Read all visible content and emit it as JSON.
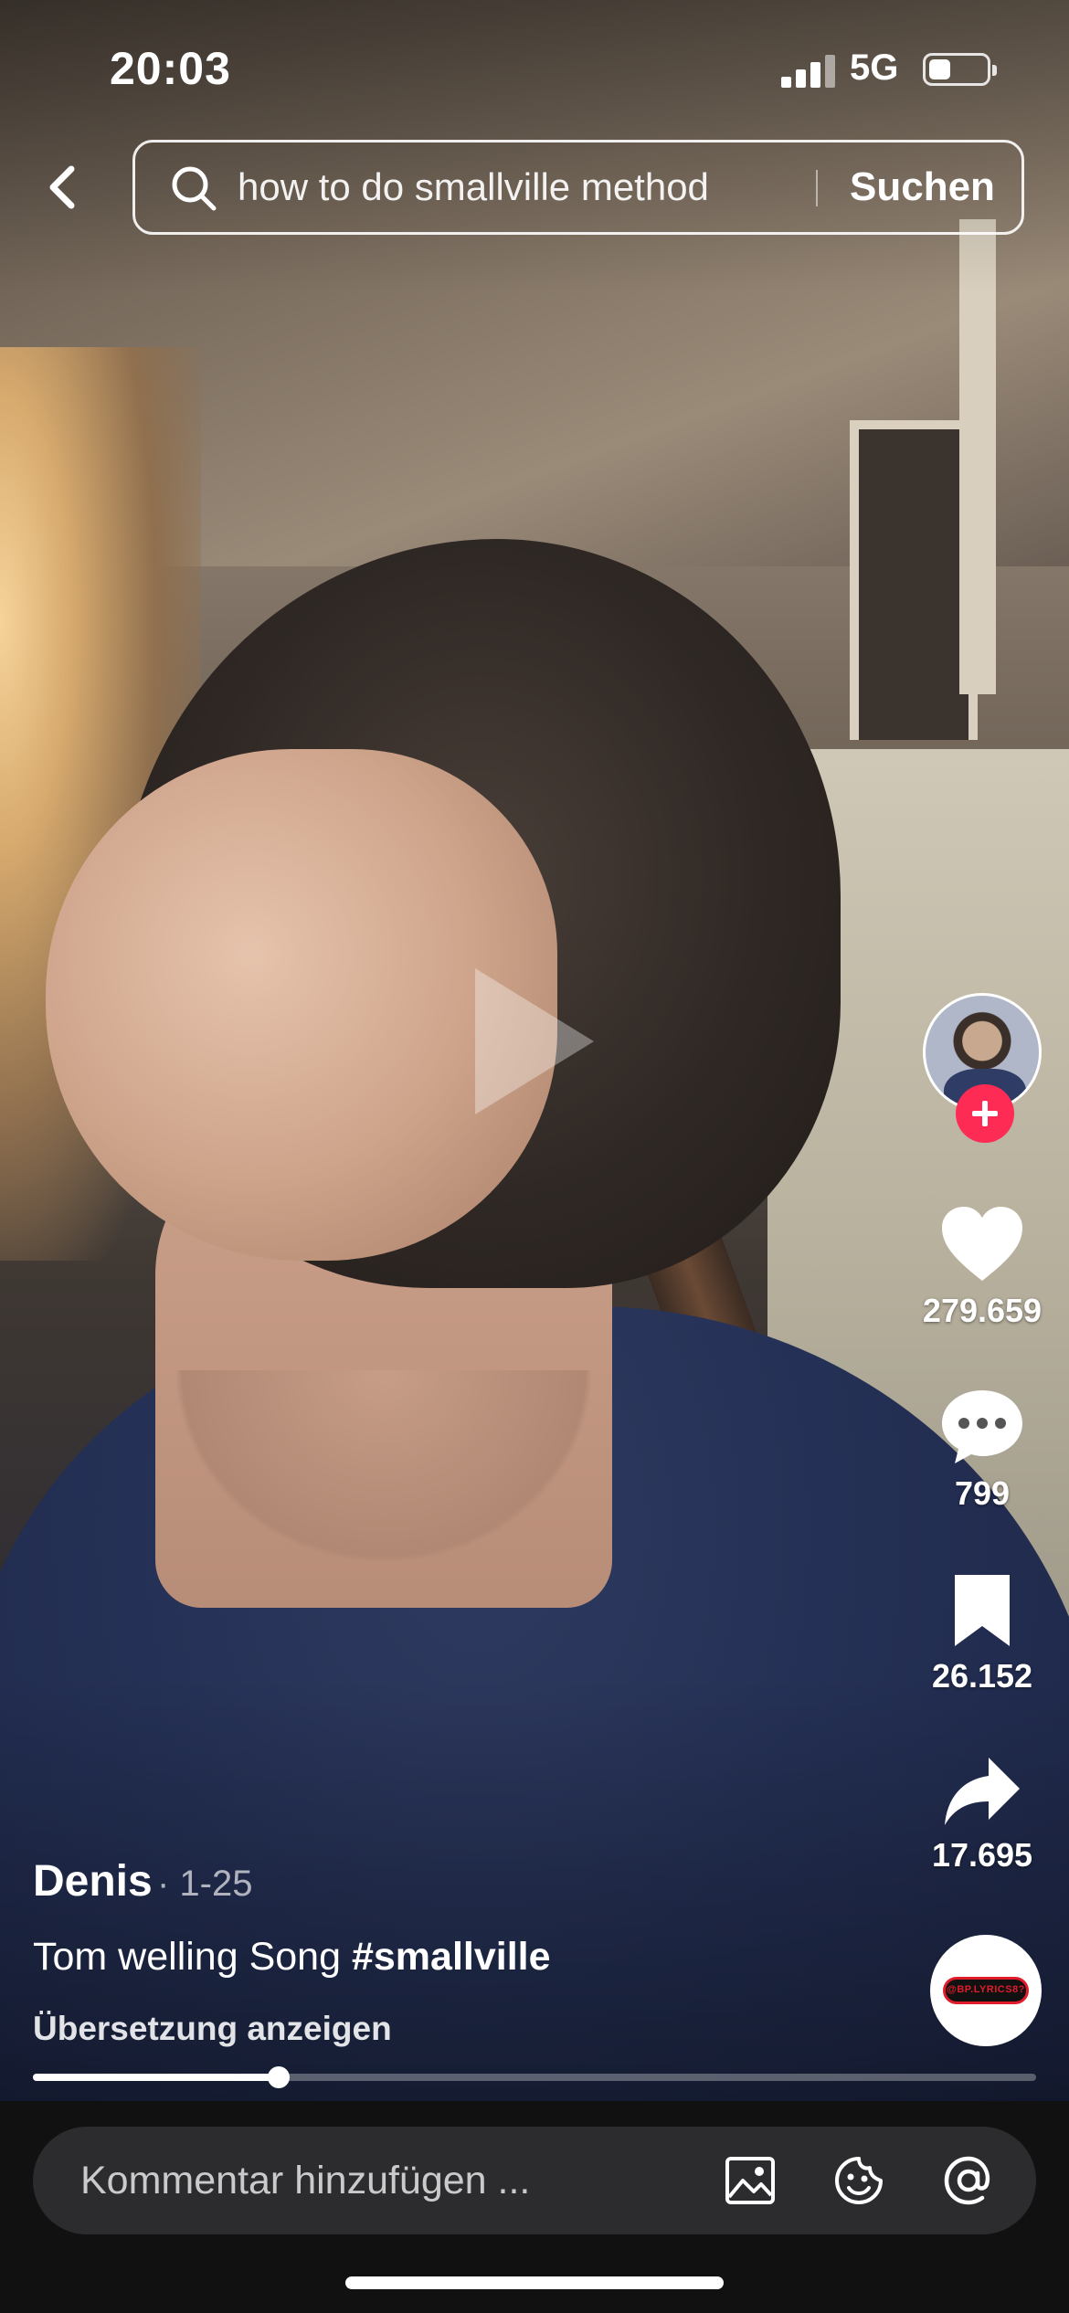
{
  "status_bar": {
    "time": "20:03",
    "network": "5G",
    "battery_level": 0.45
  },
  "search": {
    "query": "how to do smallville method",
    "button_label": "Suchen"
  },
  "actions": {
    "likes": "279.659",
    "comments": "799",
    "saves": "26.152",
    "shares": "17.695"
  },
  "music": {
    "label": "@BP.LYRICS8?"
  },
  "post": {
    "author": "Denis",
    "date": "· 1-25",
    "caption_text": "Tom welling Song ",
    "caption_tag": "#smallville",
    "translate_label": "Übersetzung anzeigen"
  },
  "playback": {
    "progress": 0.245
  },
  "comment_bar": {
    "placeholder": "Kommentar hinzufügen ..."
  },
  "colors": {
    "accent": "#fe2c55",
    "background": "#111111"
  },
  "icons": [
    "back-icon",
    "search-icon",
    "heart-icon",
    "comment-icon",
    "bookmark-icon",
    "share-icon",
    "image-icon",
    "emoji-icon",
    "mention-icon",
    "play-icon"
  ]
}
